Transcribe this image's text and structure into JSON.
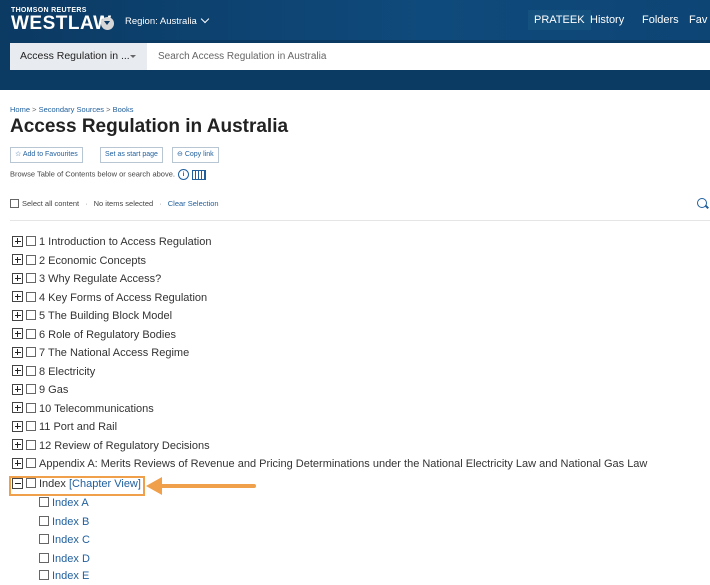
{
  "header": {
    "brand_top": "THOMSON REUTERS",
    "brand": "WESTLAW",
    "region": "Region: Australia",
    "nav": {
      "user": "PRATEEK",
      "history": "History",
      "folders": "Folders",
      "favourites": "Fav"
    }
  },
  "search": {
    "jurisdiction": "Access Regulation in ...",
    "placeholder": "Search Access Regulation in Australia"
  },
  "breadcrumb": {
    "home": "Home",
    "sep": " > ",
    "secondary": "Secondary Sources",
    "books": "Books"
  },
  "page_title": "Access Regulation in Australia",
  "actions": {
    "favourites": "Add to Favourites",
    "start_page": "Set as start page",
    "copy_link": "Copy link"
  },
  "browse_text": "Browse Table of Contents below or search above.",
  "selection": {
    "select_all": "Select all content",
    "sep": "·",
    "none_selected": "No items selected",
    "clear": "Clear Selection"
  },
  "toc": [
    {
      "label": "1 Introduction to Access Regulation"
    },
    {
      "label": "2 Economic Concepts"
    },
    {
      "label": "3 Why Regulate Access?"
    },
    {
      "label": "4 Key Forms of Access Regulation"
    },
    {
      "label": "5 The Building Block Model"
    },
    {
      "label": "6 Role of Regulatory Bodies"
    },
    {
      "label": "7 The National Access Regime"
    },
    {
      "label": "8 Electricity"
    },
    {
      "label": "9 Gas"
    },
    {
      "label": "10 Telecommunications"
    },
    {
      "label": "11 Port and Rail"
    },
    {
      "label": "12 Review of Regulatory Decisions"
    },
    {
      "label": "Appendix A: Merits Reviews of Revenue and Pricing Determinations under the National Electricity Law and National Gas Law"
    }
  ],
  "index": {
    "label": "Index",
    "chapter_view": "[Chapter View]",
    "items": [
      "Index A",
      "Index B",
      "Index C",
      "Index D",
      "Index E"
    ]
  },
  "colors": {
    "header_bg": "#0b3a63",
    "link": "#1f5f9e",
    "highlight": "#f0a04b"
  }
}
